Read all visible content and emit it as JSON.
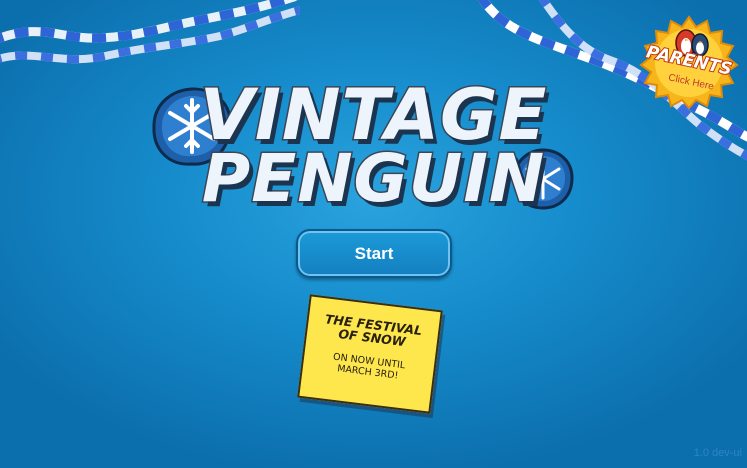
{
  "title": {
    "line1": "VINTAGE",
    "line2": "PENGUIN"
  },
  "start_button": {
    "label": "Start"
  },
  "event_note": {
    "title": "THE FESTIVAL OF SNOW",
    "subtitle": "ON NOW UNTIL MARCH 3RD!"
  },
  "parents": {
    "label": "PARENTS",
    "sub": "Click Here"
  },
  "version": "1.0 dev-ui",
  "colors": {
    "background": "#168ccc",
    "note": "#fde74d",
    "badge": "#f7b51c",
    "button": "#1a93d3"
  },
  "icons": [
    "snowflake-icon",
    "penguin-icon",
    "streamer-decoration"
  ]
}
